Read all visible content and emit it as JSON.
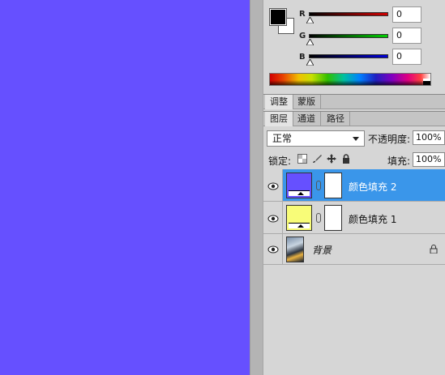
{
  "canvas": {
    "fill_color": "#6650ff"
  },
  "color_panel": {
    "foreground": "#000000",
    "background": "#ffffff",
    "channels": [
      {
        "label": "R",
        "value": "0",
        "gradient_end": "#c00000"
      },
      {
        "label": "G",
        "value": "0",
        "gradient_end": "#00c000"
      },
      {
        "label": "B",
        "value": "0",
        "gradient_end": "#0000c8"
      }
    ]
  },
  "adjust_tabs": [
    {
      "label": "调整"
    },
    {
      "label": "蒙版"
    }
  ],
  "layer_tabs": [
    {
      "label": "图层"
    },
    {
      "label": "通道"
    },
    {
      "label": "路径"
    }
  ],
  "blend": {
    "mode": "正常",
    "opacity_label": "不透明度:",
    "opacity_value": "100%"
  },
  "lock": {
    "label": "锁定:",
    "fill_label": "填充:",
    "fill_value": "100%"
  },
  "layers": [
    {
      "name": "颜色填充 2",
      "thumb_color": "#6650ff",
      "selected": true,
      "icons": [
        "eye-icon",
        "link-icon"
      ]
    },
    {
      "name": "颜色填充 1",
      "thumb_color": "#f8fc78",
      "selected": false,
      "icons": [
        "eye-icon",
        "link-icon"
      ]
    },
    {
      "name": "背景",
      "thumb_color": "#3a4a5a",
      "selected": false,
      "icons": [
        "eye-icon",
        "lock-icon"
      ]
    }
  ]
}
